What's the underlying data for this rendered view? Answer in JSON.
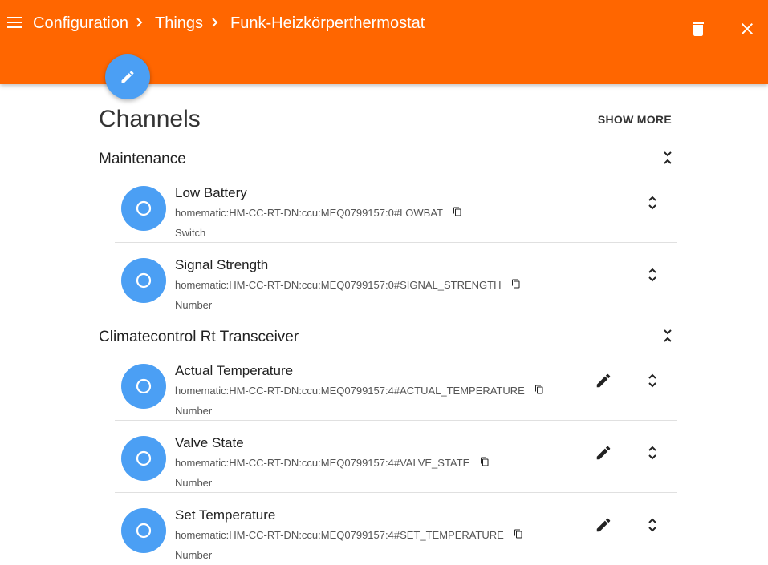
{
  "navbar": {
    "breadcrumbs": [
      "Configuration",
      "Things",
      "Funk-Heizkörperthermostat"
    ],
    "icons": {
      "menu": "menu-icon",
      "separator": "chevron-right-icon",
      "delete": "delete-icon",
      "close": "close-icon"
    }
  },
  "fab": {
    "icon": "pencil-icon"
  },
  "page": {
    "title": "Channels",
    "show_more": "SHOW MORE"
  },
  "groups": [
    {
      "label": "Maintenance",
      "items": [
        {
          "title": "Low Battery",
          "uid": "homematic:HM-CC-RT-DN:ccu:MEQ0799157:0#LOWBAT",
          "type": "Switch"
        },
        {
          "title": "Signal Strength",
          "uid": "homematic:HM-CC-RT-DN:ccu:MEQ0799157:0#SIGNAL_STRENGTH",
          "type": "Number"
        }
      ]
    },
    {
      "label": "Climatecontrol Rt Transceiver",
      "items": [
        {
          "title": "Actual Temperature",
          "uid": "homematic:HM-CC-RT-DN:ccu:MEQ0799157:4#ACTUAL_TEMPERATURE",
          "type": "Number"
        },
        {
          "title": "Valve State",
          "uid": "homematic:HM-CC-RT-DN:ccu:MEQ0799157:4#VALVE_STATE",
          "type": "Number"
        },
        {
          "title": "Set Temperature",
          "uid": "homematic:HM-CC-RT-DN:ccu:MEQ0799157:4#SET_TEMPERATURE",
          "type": "Number"
        }
      ]
    }
  ],
  "colors": {
    "accent": "#ff6600",
    "avatar": "#4b9ff4"
  }
}
